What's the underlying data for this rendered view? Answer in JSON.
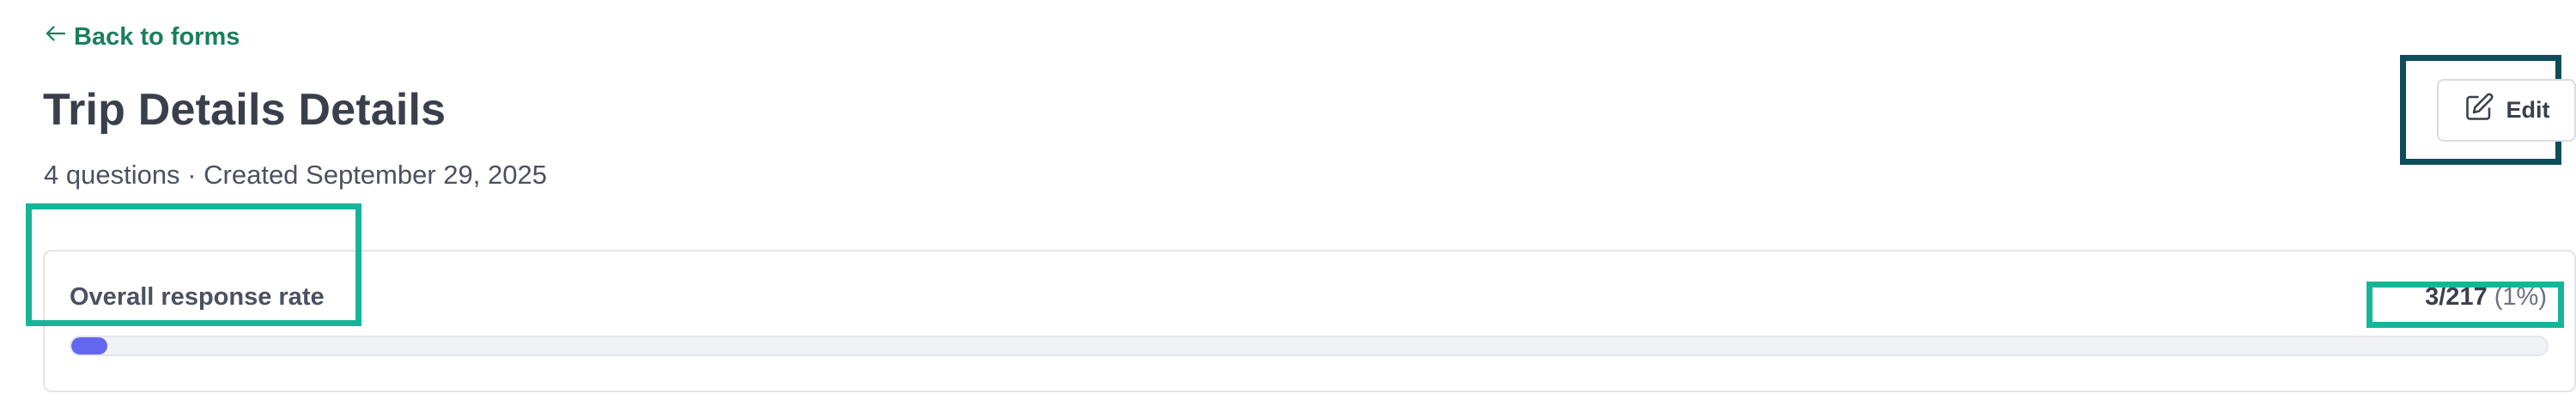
{
  "nav": {
    "back_label": "Back to forms"
  },
  "form": {
    "title": "Trip Details Details",
    "question_count": "4 questions",
    "separator": "·",
    "created": "Created September 29, 2025"
  },
  "actions": {
    "edit_label": "Edit"
  },
  "response_rate": {
    "label": "Overall response rate",
    "count": "3/217",
    "percent_text": "(1%)",
    "progress_fraction": 0.014
  },
  "colors": {
    "accent_green": "#1a7f5a",
    "progress_fill": "#6366f1",
    "highlight_teal": "#18b49a",
    "highlight_dark": "#0e4d5e"
  },
  "icons": {
    "back": "arrow-left-icon",
    "edit": "pencil-square-icon"
  }
}
